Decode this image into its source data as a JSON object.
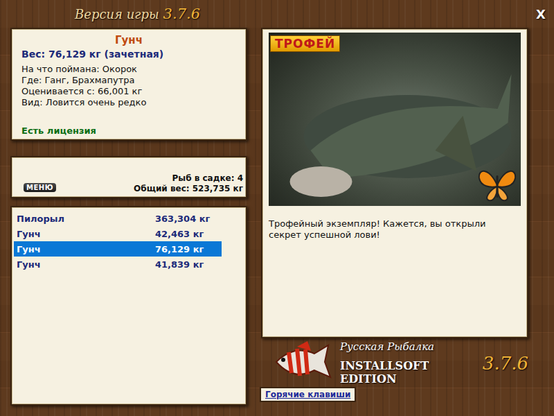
{
  "window": {
    "title": "Версия игры",
    "version": "3.7.6",
    "close": "X"
  },
  "fish": {
    "name": "Гунч",
    "weight": "Вес: 76,129 кг (зачетная)",
    "details": [
      "На что поймана: Окорок",
      "Где: Ганг, Брахмапутра",
      "Оценивается с: 66,001 кг",
      "Вид: Ловится очень редко"
    ],
    "license": "Есть лицензия"
  },
  "menu_button": "МЕНЮ",
  "keepnet": {
    "count": "Рыб в садке: 4",
    "total": "Общий вес: 523,735 кг"
  },
  "catch_list": [
    {
      "name": "Пилорыл",
      "weight": "363,304 кг",
      "selected": false
    },
    {
      "name": "Гунч",
      "weight": "42,463 кг",
      "selected": false
    },
    {
      "name": "Гунч",
      "weight": "76,129 кг",
      "selected": true
    },
    {
      "name": "Гунч",
      "weight": "41,839 кг",
      "selected": false
    }
  ],
  "photo": {
    "badge": "ТРОФЕЙ"
  },
  "message": "Трофейный экземпляр! Кажется, вы открыли секрет успешной лови!",
  "brand": {
    "name": "Русская Рыбалка",
    "edition": "INSTALLSOFT EDITION",
    "version": "3.7.6"
  },
  "hotkeys_button": "Горячие клавиши"
}
